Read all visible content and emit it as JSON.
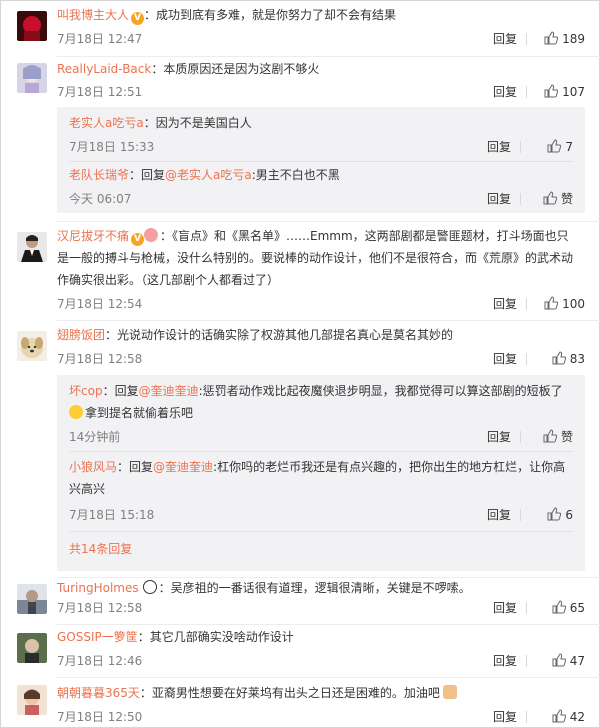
{
  "comments": [
    {
      "user": "叫我博主大人",
      "text": "：成功到底有多难，就是你努力了却不会有结果",
      "time": "7月18日 12:47",
      "reply_label": "回复",
      "likes": "189"
    },
    {
      "user": "ReallyLaid-Back",
      "text": "：本质原因还是因为这剧不够火",
      "time": "7月18日 12:51",
      "reply_label": "回复",
      "likes": "107",
      "replies": [
        {
          "user": "老实人a吃亏a",
          "text": "：因为不是美国白人",
          "time": "7月18日 15:33",
          "reply_label": "回复",
          "likes": "7"
        },
        {
          "user": "老队长瑞爷",
          "prefix": "：回复",
          "at": "@老实人a吃亏a",
          "text": ":男主不白也不黑",
          "time": "今天 06:07",
          "reply_label": "回复",
          "likes": "赞"
        }
      ]
    },
    {
      "user": "汉尼拔牙不痛",
      "text_line1": "：《盲点》和《黑名单》……Emmm，这两部剧都是警匪题材，打斗场面也只",
      "text_line2": "是一般的搏斗与枪械，没什么特别的。要说棒的动作设计，他们不是很符合，而《荒原》的武术动",
      "text_line3": "作确实很出彩。（这几部剧个人都看过了）",
      "time": "7月18日 12:54",
      "reply_label": "回复",
      "likes": "100"
    },
    {
      "user": "翅膀饭团",
      "text": "：光说动作设计的话确实除了权游其他几部提名真心是莫名其妙的",
      "time": "7月18日 12:58",
      "reply_label": "回复",
      "likes": "83",
      "replies": [
        {
          "user": "坏cop",
          "prefix": "：回复",
          "at": "@奎迪奎迪",
          "text": ":惩罚者动作戏比起夜魔侠退步明显，我都觉得可以算这部剧的短板了",
          "text_line2": "拿到提名就偷着乐吧",
          "time": "14分钟前",
          "reply_label": "回复",
          "likes": "赞"
        },
        {
          "user": "小狼风马",
          "prefix": "：回复",
          "at": "@奎迪奎迪",
          "text": ":杠你吗的老烂币我还是有点兴趣的，把你出生的地方杠烂，让你高",
          "text_line2": "兴高兴",
          "time": "7月18日 15:18",
          "reply_label": "回复",
          "likes": "6"
        }
      ],
      "more_label": "共14条回复"
    },
    {
      "user": "TuringHolmes",
      "text": "：吴彦祖的一番话很有道理，逻辑很清晰，关键是不啰嗦。",
      "time": "7月18日 12:58",
      "reply_label": "回复",
      "likes": "65"
    },
    {
      "user": "GOSSIP一箩筐",
      "text": "：其它几部确实没啥动作设计",
      "time": "7月18日 12:46",
      "reply_label": "回复",
      "likes": "47"
    },
    {
      "user": "朝朝暮暮365天",
      "text": "：亚裔男性想要在好莱坞有出头之日还是困难的。加油吧",
      "time": "7月18日 12:50",
      "reply_label": "回复",
      "likes": "42"
    }
  ]
}
